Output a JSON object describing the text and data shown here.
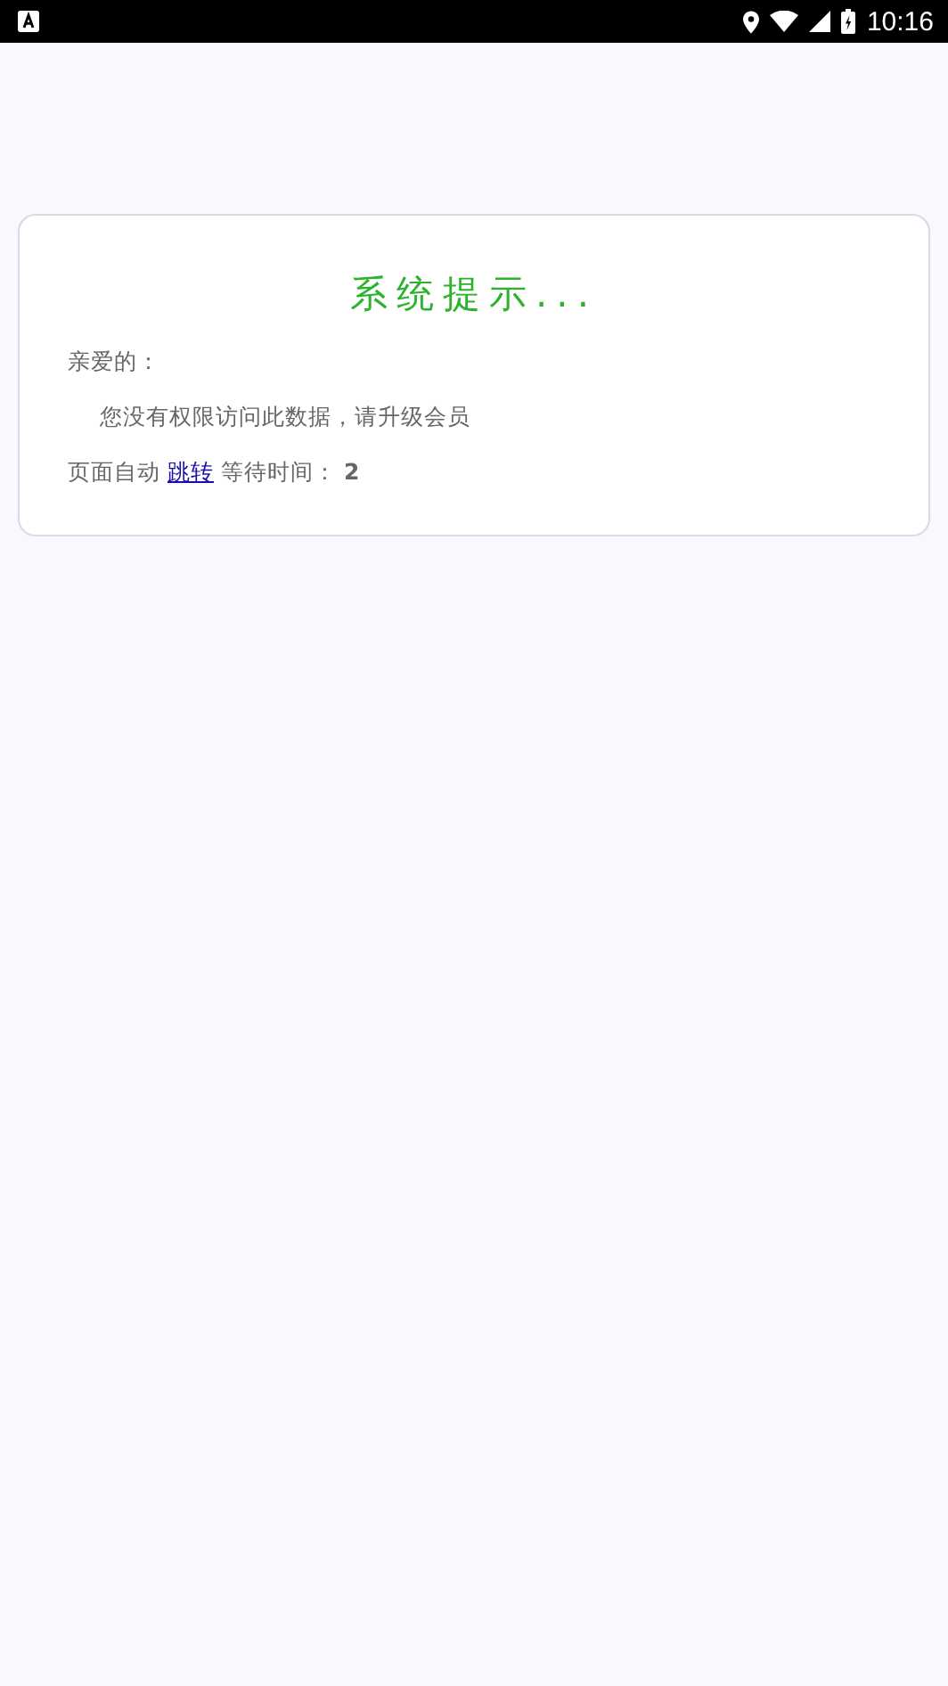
{
  "status_bar": {
    "time": "10:16"
  },
  "dialog": {
    "title": "系统提示...",
    "greeting": "亲爱的：",
    "message": "您没有权限访问此数据，请升级会员",
    "redirect": {
      "prefix": "页面自动",
      "link": "跳转",
      "suffix": "等待时间：",
      "seconds": "2"
    }
  }
}
